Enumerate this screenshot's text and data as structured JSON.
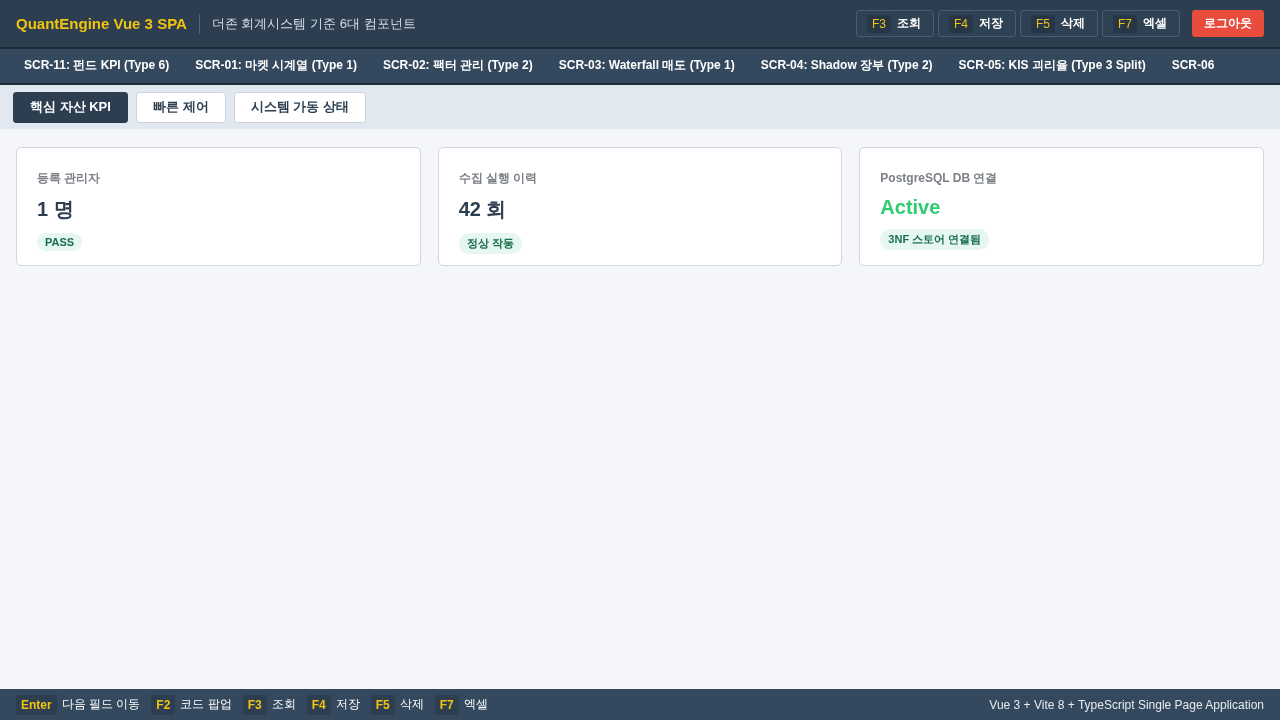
{
  "header": {
    "title": "QuantEngine Vue 3 SPA",
    "subtitle": "더존 회계시스템 기준 6대 컴포넌트",
    "actions": [
      {
        "key": "F3",
        "label": "조회"
      },
      {
        "key": "F4",
        "label": "저장"
      },
      {
        "key": "F5",
        "label": "삭제"
      },
      {
        "key": "F7",
        "label": "엑셀"
      }
    ],
    "logout": "로그아웃"
  },
  "screens": [
    {
      "label": "SCR-11: 펀드 KPI (Type 6)",
      "selected": false
    },
    {
      "label": "SCR-01: 마켓 시계열 (Type 1)",
      "selected": false
    },
    {
      "label": "SCR-02: 팩터 관리 (Type 2)",
      "selected": false
    },
    {
      "label": "SCR-03: Waterfall 매도 (Type 1)",
      "selected": false
    },
    {
      "label": "SCR-04: Shadow 장부 (Type 2)",
      "selected": false
    },
    {
      "label": "SCR-05: KIS 괴리율 (Type 3 Split)",
      "selected": false
    },
    {
      "label": "SCR-06",
      "selected": false
    }
  ],
  "tabs": [
    {
      "label": "핵심 자산 KPI",
      "selected": true
    },
    {
      "label": "빠른 제어",
      "selected": false
    },
    {
      "label": "시스템 가동 상태",
      "selected": false
    }
  ],
  "cards": [
    {
      "label": "등록 관리자",
      "value": "1 명",
      "kind": "count",
      "badge": "PASS"
    },
    {
      "label": "수집 실행 이력",
      "value": "42 회",
      "kind": "count",
      "badge": "정상 작동"
    },
    {
      "label": "PostgreSQL DB 연결",
      "value": "Active",
      "kind": "status",
      "badge": "3NF 스토어 연결됨"
    }
  ],
  "status_bar": {
    "shortcuts": [
      {
        "key": "Enter",
        "label": "다음 필드 이동"
      },
      {
        "key": "F2",
        "label": "코드 팝업"
      },
      {
        "key": "F3",
        "label": "조회"
      },
      {
        "key": "F4",
        "label": "저장"
      },
      {
        "key": "F5",
        "label": "삭제"
      },
      {
        "key": "F7",
        "label": "엑셀"
      }
    ],
    "info": "Vue 3 + Vite 8 + TypeScript Single Page Application"
  }
}
